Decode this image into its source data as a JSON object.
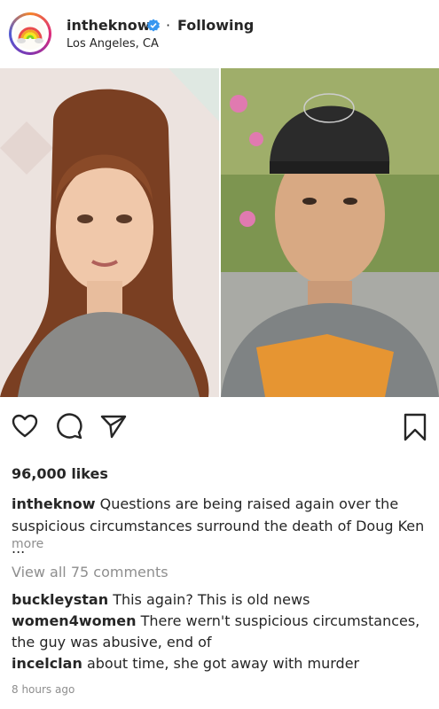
{
  "header": {
    "username": "intheknow",
    "separator": "·",
    "follow_status": "Following",
    "location": "Los Angeles, CA"
  },
  "post": {
    "likes": "96,000 likes",
    "caption_user": "intheknow",
    "caption_text": "Questions are being raised again over the suspicious circumstances surround the death of Doug Ken ...",
    "more_label": "more",
    "view_all": "View all 75 comments",
    "comments": [
      {
        "user": "buckleystan",
        "text": "This again? This is old news"
      },
      {
        "user": "women4women",
        "text": "There wern't suspicious circumstances, the guy was abusive, end of"
      },
      {
        "user": "incelclan",
        "text": "about time, she got away with murder"
      }
    ],
    "timestamp": "8 hours ago"
  },
  "icons": {
    "like": "heart-icon",
    "comment": "comment-icon",
    "share": "share-icon",
    "save": "bookmark-icon",
    "verified": "verified-badge-icon"
  },
  "colors": {
    "verified": "#3897f0",
    "secondary_text": "#8e8e8e",
    "primary_text": "#262626"
  }
}
